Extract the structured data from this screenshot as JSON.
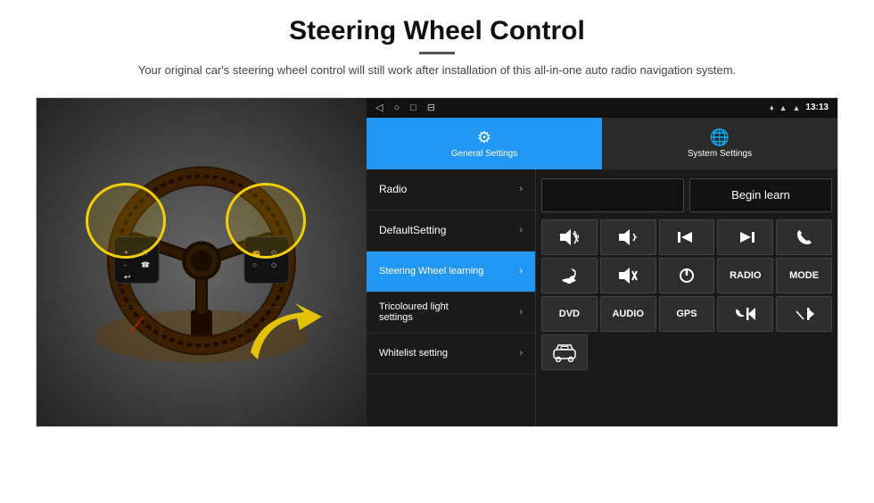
{
  "header": {
    "title": "Steering Wheel Control",
    "subtitle": "Your original car's steering wheel control will still work after installation of this all-in-one auto radio navigation system.",
    "divider": true
  },
  "status_bar": {
    "icons": [
      "◁",
      "○",
      "□",
      "⊟"
    ],
    "time": "13:13",
    "signal_icons": [
      "♥",
      "▲"
    ]
  },
  "tabs": [
    {
      "id": "general",
      "label": "General Settings",
      "active": true
    },
    {
      "id": "system",
      "label": "System Settings",
      "active": false
    }
  ],
  "menu_items": [
    {
      "id": "radio",
      "label": "Radio",
      "active": false
    },
    {
      "id": "default",
      "label": "DefaultSetting",
      "active": false
    },
    {
      "id": "steering",
      "label": "Steering Wheel learning",
      "active": true
    },
    {
      "id": "tricolour",
      "label": "Tricoloured light settings",
      "active": false
    },
    {
      "id": "whitelist",
      "label": "Whitelist setting",
      "active": false
    }
  ],
  "controls": {
    "begin_learn_label": "Begin learn",
    "radio_label": "Radio",
    "rows": [
      [
        "🔊+",
        "🔊-",
        "⏮",
        "⏭",
        "📞"
      ],
      [
        "📞",
        "🔇",
        "⏻",
        "RADIO",
        "MODE"
      ],
      [
        "DVD",
        "AUDIO",
        "GPS",
        "📞⏮",
        "↙⏭"
      ]
    ]
  },
  "icons": {
    "gear": "⚙",
    "globe": "🌐",
    "chevron_right": "›",
    "location": "♦"
  }
}
